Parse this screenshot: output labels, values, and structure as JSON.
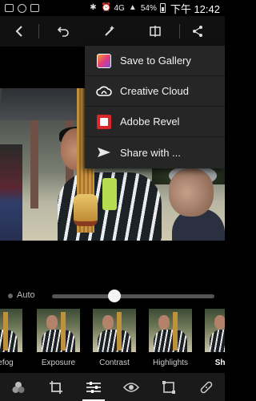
{
  "status_bar": {
    "network": "4G",
    "battery": "54%",
    "time": "下午 12:42",
    "icons": [
      "photo-icon",
      "messenger-icon",
      "gallery-icon",
      "bluetooth-icon",
      "alarm-icon",
      "wifi-icon",
      "signal-icon",
      "battery-icon"
    ]
  },
  "toolbar": {
    "icons": [
      "back-chevron-icon",
      "undo-icon",
      "magic-wand-icon",
      "compare-icon",
      "share-icon"
    ]
  },
  "share_menu": {
    "items": [
      {
        "label": "Save to Gallery",
        "icon": "gallery-icon"
      },
      {
        "label": "Creative Cloud",
        "icon": "creative-cloud-icon"
      },
      {
        "label": "Adobe Revel",
        "icon": "adobe-revel-icon"
      },
      {
        "label": "Share with ...",
        "icon": "share-arrow-icon"
      }
    ]
  },
  "adjust": {
    "auto_label": "Auto",
    "slider_value": 0.5
  },
  "presets": [
    {
      "label": "efog"
    },
    {
      "label": "Exposure"
    },
    {
      "label": "Contrast"
    },
    {
      "label": "Highlights"
    },
    {
      "label": "Shad"
    }
  ],
  "bottom_bar": {
    "icons": [
      "looks-icon",
      "crop-icon",
      "adjust-sliders-icon",
      "eye-icon",
      "frame-icon",
      "bandage-icon"
    ],
    "active_index": 2
  },
  "colors": {
    "background": "#000000",
    "menu_bg": "#262626",
    "accent": "#ffffff"
  }
}
